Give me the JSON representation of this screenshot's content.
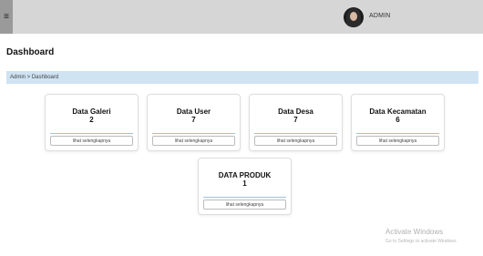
{
  "header": {
    "menu_icon": "≡",
    "user_name": "ADMIN"
  },
  "page": {
    "title": "Dashboard",
    "breadcrumb": "Admin > Dashboard"
  },
  "cards": [
    {
      "title": "Data Galeri",
      "value": "2",
      "more": "lihat selengkapnya"
    },
    {
      "title": "Data User",
      "value": "7",
      "more": "lihat selengkapnya"
    },
    {
      "title": "Data Desa",
      "value": "7",
      "more": "lihat selengkapnya"
    },
    {
      "title": "Data Kecamatan",
      "value": "6",
      "more": "lihat selengkapnya"
    },
    {
      "title": "DATA PRODUK",
      "value": "1",
      "more": "lihat selengkapnya"
    }
  ],
  "watermark": {
    "line1": "Activate Windows",
    "line2": "Go to Settings to activate Windows."
  }
}
